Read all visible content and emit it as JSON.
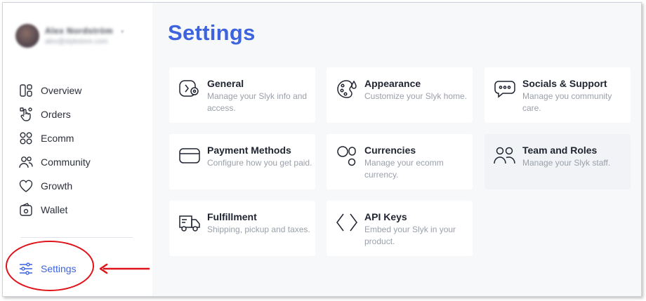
{
  "sidebar": {
    "profile": {
      "name": "Alex Nordström",
      "subtitle": "alex@slykstore.com"
    },
    "nav_items": [
      {
        "label": "Overview",
        "icon": "layout-grid-icon"
      },
      {
        "label": "Orders",
        "icon": "hand-pointer-icon"
      },
      {
        "label": "Ecomm",
        "icon": "four-circles-icon"
      },
      {
        "label": "Community",
        "icon": "users-icon"
      },
      {
        "label": "Growth",
        "icon": "heart-icon"
      },
      {
        "label": "Wallet",
        "icon": "wallet-icon"
      }
    ],
    "settings_label": "Settings"
  },
  "main": {
    "title": "Settings",
    "cards": [
      {
        "title": "General",
        "description": "Manage your Slyk info and access.",
        "icon": "general-settings-icon"
      },
      {
        "title": "Appearance",
        "description": "Customize your Slyk home.",
        "icon": "palette-icon"
      },
      {
        "title": "Socials & Support",
        "description": "Manage you community care.",
        "icon": "chat-bubble-icon"
      },
      {
        "title": "Payment Methods",
        "description": "Configure how you get paid.",
        "icon": "card-icon"
      },
      {
        "title": "Currencies",
        "description": "Manage your ecomm currency.",
        "icon": "currencies-icon"
      },
      {
        "title": "Team and Roles",
        "description": "Manage your Slyk staff.",
        "icon": "team-icon"
      },
      {
        "title": "Fulfillment",
        "description": "Shipping, pickup and taxes.",
        "icon": "truck-icon"
      },
      {
        "title": "API Keys",
        "description": "Embed your Slyk in your product.",
        "icon": "code-brackets-icon"
      }
    ]
  },
  "colors": {
    "accent": "#3d63dd",
    "annotation": "#e0121a",
    "background": "#f7f8fa"
  }
}
